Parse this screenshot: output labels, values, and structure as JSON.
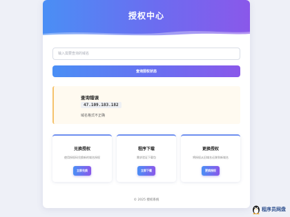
{
  "header": {
    "title": "授权中心"
  },
  "search": {
    "placeholder": "输入需要查询的域名",
    "button_label": "查询授权状态"
  },
  "result": {
    "title": "查询错误",
    "ip": "47.109.183.182",
    "message": "域名格式不正确"
  },
  "features": [
    {
      "title": "兑换授权",
      "desc": "使用授权码兑换新的域名授权",
      "button": "立即兑换"
    },
    {
      "title": "程序下载",
      "desc": "需求验证下载包",
      "button": "立即下载"
    },
    {
      "title": "更换授权",
      "desc": "将授权从旧域名迁移到新域名",
      "button": "更换授权"
    }
  ],
  "footer": {
    "text": "© 2025 授权系统"
  },
  "watermark": {
    "text": "程序员网盘",
    "icon": "penguin-icon"
  },
  "colors": {
    "accent_start": "#4a8ff5",
    "accent_end": "#8a58ea",
    "warning_border": "#f5c26b",
    "page_bg": "#eef0f7"
  }
}
